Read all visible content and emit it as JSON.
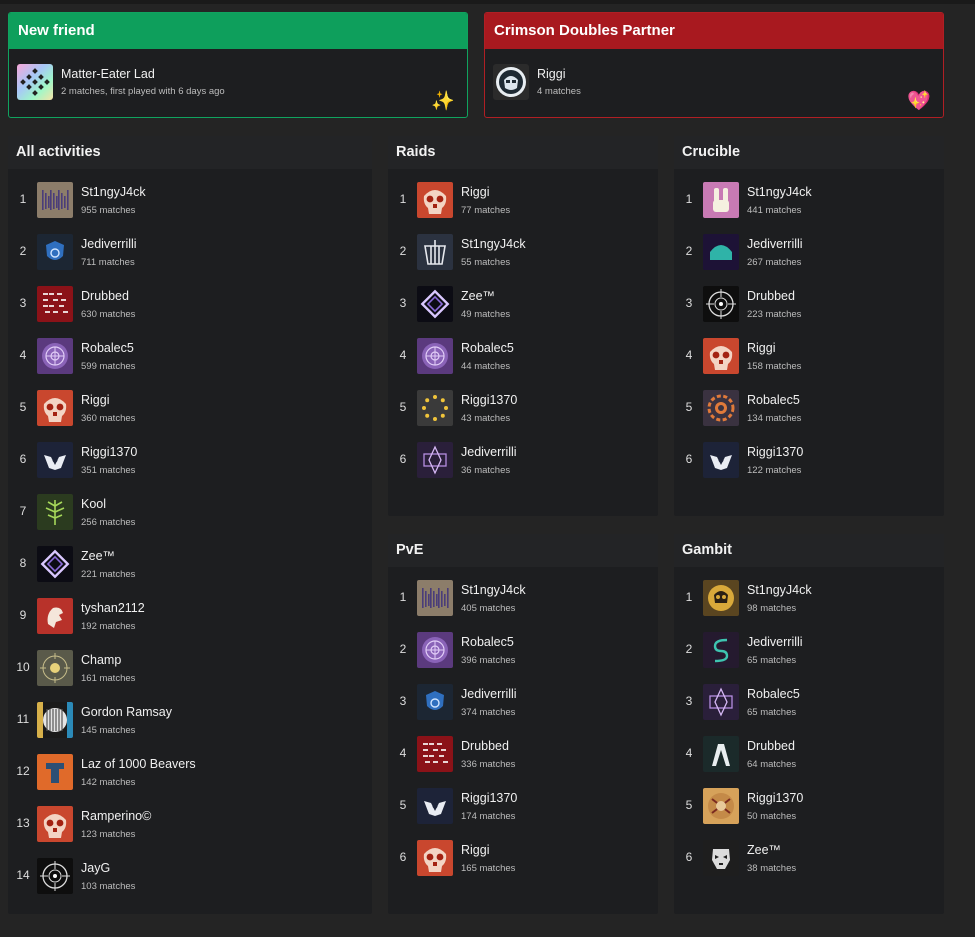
{
  "highlights": [
    {
      "title": "New friend",
      "name": "Matter-Eater Lad",
      "detail": "2 matches, first played with 6 days ago",
      "emoji": "✨",
      "accent": "#0e9f5c"
    },
    {
      "title": "Crimson Doubles Partner",
      "name": "Riggi",
      "detail": "4 matches",
      "emoji": "💖",
      "accent": "#a8191f"
    }
  ],
  "panels": {
    "all": {
      "title": "All activities",
      "rows": [
        {
          "rank": "1",
          "name": "St1ngyJ4ck",
          "matches": "955 matches",
          "icon": "barcode-emblem"
        },
        {
          "rank": "2",
          "name": "Jediverrilli",
          "matches": "711 matches",
          "icon": "shield-emblem"
        },
        {
          "rank": "3",
          "name": "Drubbed",
          "matches": "630 matches",
          "icon": "glyph-emblem"
        },
        {
          "rank": "4",
          "name": "Robalec5",
          "matches": "599 matches",
          "icon": "purple-sigil-emblem"
        },
        {
          "rank": "5",
          "name": "Riggi",
          "matches": "360 matches",
          "icon": "skull-emblem"
        },
        {
          "rank": "6",
          "name": "Riggi1370",
          "matches": "351 matches",
          "icon": "ghost-emblem"
        },
        {
          "rank": "7",
          "name": "Kool",
          "matches": "256 matches",
          "icon": "tree-emblem"
        },
        {
          "rank": "8",
          "name": "Zee™",
          "matches": "221 matches",
          "icon": "diamond-emblem"
        },
        {
          "rank": "9",
          "name": "tyshan2112",
          "matches": "192 matches",
          "icon": "lion-emblem"
        },
        {
          "rank": "10",
          "name": "Champ",
          "matches": "161 matches",
          "icon": "sun-emblem"
        },
        {
          "rank": "11",
          "name": "Gordon Ramsay",
          "matches": "145 matches",
          "icon": "circle-stripes-emblem"
        },
        {
          "rank": "12",
          "name": "Laz of 1000 Beavers",
          "matches": "142 matches",
          "icon": "orange-banner-emblem"
        },
        {
          "rank": "13",
          "name": "Ramperino©",
          "matches": "123 matches",
          "icon": "skull-emblem"
        },
        {
          "rank": "14",
          "name": "JayG",
          "matches": "103 matches",
          "icon": "crosshair-emblem"
        }
      ]
    },
    "raids": {
      "title": "Raids",
      "rows": [
        {
          "rank": "1",
          "name": "Riggi",
          "matches": "77 matches",
          "icon": "skull-emblem"
        },
        {
          "rank": "2",
          "name": "St1ngyJ4ck",
          "matches": "55 matches",
          "icon": "crown-emblem"
        },
        {
          "rank": "3",
          "name": "Zee™",
          "matches": "49 matches",
          "icon": "diamond-emblem"
        },
        {
          "rank": "4",
          "name": "Robalec5",
          "matches": "44 matches",
          "icon": "purple-sigil-emblem"
        },
        {
          "rank": "5",
          "name": "Riggi1370",
          "matches": "43 matches",
          "icon": "dots-ring-emblem"
        },
        {
          "rank": "6",
          "name": "Jediverrilli",
          "matches": "36 matches",
          "icon": "purple-gem-emblem"
        }
      ]
    },
    "crucible": {
      "title": "Crucible",
      "rows": [
        {
          "rank": "1",
          "name": "St1ngyJ4ck",
          "matches": "441 matches",
          "icon": "bunny-emblem"
        },
        {
          "rank": "2",
          "name": "Jediverrilli",
          "matches": "267 matches",
          "icon": "teal-arch-emblem"
        },
        {
          "rank": "3",
          "name": "Drubbed",
          "matches": "223 matches",
          "icon": "crosshair-emblem"
        },
        {
          "rank": "4",
          "name": "Riggi",
          "matches": "158 matches",
          "icon": "skull-emblem"
        },
        {
          "rank": "5",
          "name": "Robalec5",
          "matches": "134 matches",
          "icon": "orange-gear-emblem"
        },
        {
          "rank": "6",
          "name": "Riggi1370",
          "matches": "122 matches",
          "icon": "ghost-emblem"
        }
      ]
    },
    "pve": {
      "title": "PvE",
      "rows": [
        {
          "rank": "1",
          "name": "St1ngyJ4ck",
          "matches": "405 matches",
          "icon": "barcode-emblem"
        },
        {
          "rank": "2",
          "name": "Robalec5",
          "matches": "396 matches",
          "icon": "purple-sigil-emblem"
        },
        {
          "rank": "3",
          "name": "Jediverrilli",
          "matches": "374 matches",
          "icon": "shield-emblem"
        },
        {
          "rank": "4",
          "name": "Drubbed",
          "matches": "336 matches",
          "icon": "glyph-emblem"
        },
        {
          "rank": "5",
          "name": "Riggi1370",
          "matches": "174 matches",
          "icon": "ghost-emblem"
        },
        {
          "rank": "6",
          "name": "Riggi",
          "matches": "165 matches",
          "icon": "skull-emblem"
        }
      ]
    },
    "gambit": {
      "title": "Gambit",
      "rows": [
        {
          "rank": "1",
          "name": "St1ngyJ4ck",
          "matches": "98 matches",
          "icon": "gold-skull-emblem"
        },
        {
          "rank": "2",
          "name": "Jediverrilli",
          "matches": "65 matches",
          "icon": "serpent-emblem"
        },
        {
          "rank": "3",
          "name": "Robalec5",
          "matches": "65 matches",
          "icon": "purple-gem-emblem"
        },
        {
          "rank": "4",
          "name": "Drubbed",
          "matches": "64 matches",
          "icon": "arch-emblem"
        },
        {
          "rank": "5",
          "name": "Riggi1370",
          "matches": "50 matches",
          "icon": "tan-skull-emblem"
        },
        {
          "rank": "6",
          "name": "Zee™",
          "matches": "38 matches",
          "icon": "mask-emblem"
        }
      ]
    }
  }
}
